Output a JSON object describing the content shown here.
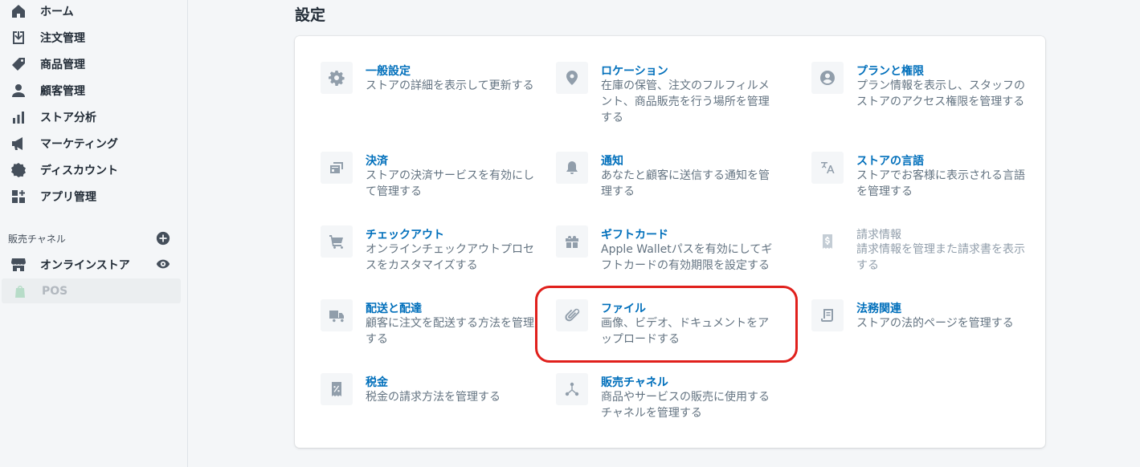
{
  "sidebar": {
    "items": [
      {
        "label": "ホーム",
        "icon": "home-icon"
      },
      {
        "label": "注文管理",
        "icon": "orders-icon"
      },
      {
        "label": "商品管理",
        "icon": "tag-icon"
      },
      {
        "label": "顧客管理",
        "icon": "customer-icon"
      },
      {
        "label": "ストア分析",
        "icon": "analytics-icon"
      },
      {
        "label": "マーケティング",
        "icon": "megaphone-icon"
      },
      {
        "label": "ディスカウント",
        "icon": "discount-icon"
      },
      {
        "label": "アプリ管理",
        "icon": "apps-icon"
      }
    ],
    "channels_title": "販売チャネル",
    "channels": [
      {
        "label": "オンラインストア",
        "icon": "store-icon"
      },
      {
        "label": "POS",
        "icon": "shopify-bag-icon"
      }
    ]
  },
  "page": {
    "title": "設定"
  },
  "settings": {
    "general": {
      "title": "一般設定",
      "desc": "ストアの詳細を表示して更新する"
    },
    "locations": {
      "title": "ロケーション",
      "desc": "在庫の保管、注文のフルフィルメント、商品販売を行う場所を管理する"
    },
    "plan": {
      "title": "プランと権限",
      "desc": "プラン情報を表示し、スタッフのストアのアクセス権限を管理する"
    },
    "payments": {
      "title": "決済",
      "desc": "ストアの決済サービスを有効にして管理する"
    },
    "notifications": {
      "title": "通知",
      "desc": "あなたと顧客に送信する通知を管理する"
    },
    "languages": {
      "title": "ストアの言語",
      "desc": "ストアでお客様に表示される言語を管理する"
    },
    "checkout": {
      "title": "チェックアウト",
      "desc": "オンラインチェックアウトプロセスをカスタマイズする"
    },
    "gift_cards": {
      "title": "ギフトカード",
      "desc": "Apple Walletパスを有効にしてギフトカードの有効期限を設定する"
    },
    "billing": {
      "title": "請求情報",
      "desc": "請求情報を管理また請求書を表示する"
    },
    "shipping": {
      "title": "配送と配達",
      "desc": "顧客に注文を配送する方法を管理する"
    },
    "files": {
      "title": "ファイル",
      "desc": "画像、ビデオ、ドキュメントをアップロードする"
    },
    "legal": {
      "title": "法務関連",
      "desc": "ストアの法的ページを管理する"
    },
    "taxes": {
      "title": "税金",
      "desc": "税金の請求方法を管理する"
    },
    "sales_channels": {
      "title": "販売チャネル",
      "desc": "商品やサービスの販売に使用するチャネルを管理する"
    }
  },
  "colors": {
    "link": "#006fbb",
    "highlight": "#e0201c",
    "background": "#f4f6f8"
  }
}
